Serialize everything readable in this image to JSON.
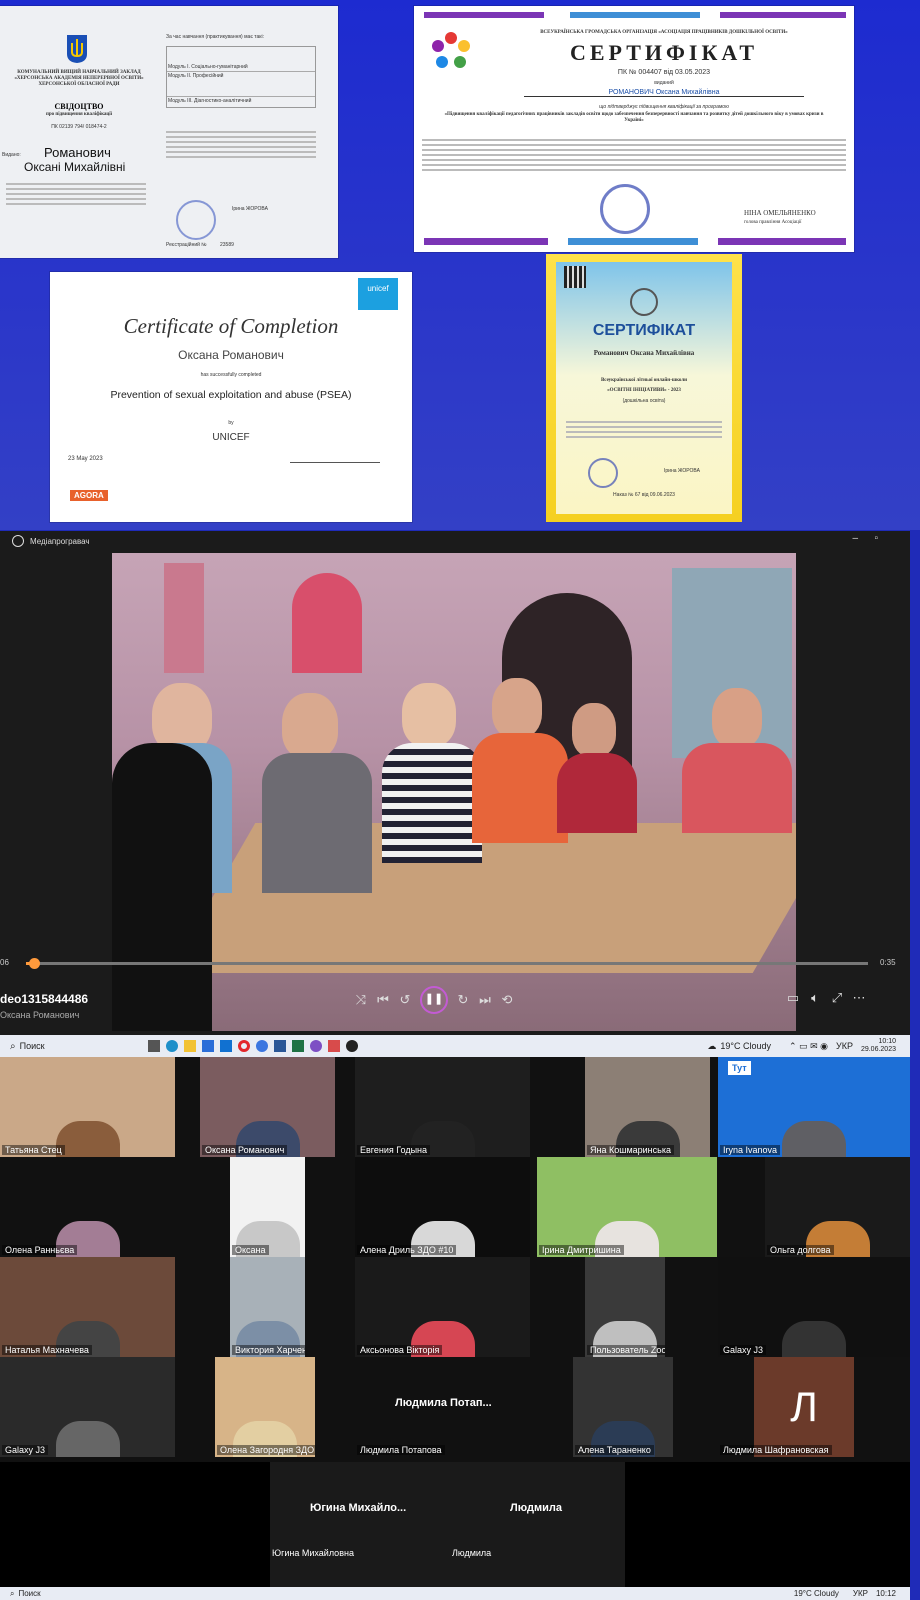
{
  "collage": {
    "cert_left": {
      "institution": "КОМУНАЛЬНИЙ ВИЩИЙ НАВЧАЛЬНИЙ ЗАКЛАД «ХЕРСОНСЬКА АКАДЕМІЯ НЕПЕРЕРВНОЇ ОСВІТИ» ХЕРСОНСЬКОЇ ОБЛАСНОЇ РАДИ",
      "title": "СВІДОЦТВО",
      "subtitle": "про підвищення кваліфікації",
      "number": "ПК 02139 794/ 018474-2",
      "issued_label": "Видано:",
      "surname": "Романович",
      "name": "Оксані Михайлівні",
      "head": "Ірина ЖОРОВА",
      "reg_label": "Реєстраційний №",
      "reg_number": "23589",
      "table_header": "За час навчання (практикування) має такі:",
      "module_1": "Модуль I. Соціально-гуманітарний",
      "module_2": "Модуль II. Професійний",
      "module_3": "Модуль III. Діагностико-аналітичний"
    },
    "cert_assoc": {
      "org": "ВСЕУКРАЇНСЬКА ГРОМАДСЬКА ОРГАНІЗАЦІЯ «АСОЦІАЦІЯ ПРАЦІВНИКІВ ДОШКІЛЬНОЇ ОСВІТИ»",
      "title": "СЕРТИФІКАТ",
      "number_line": "ПК № 004407 від 03.05.2023",
      "issued": "виданий",
      "recipient": "РОМАНОВИЧ Оксана Михайлівна",
      "confirms": "що підтверджує підвищення кваліфікації за програмою",
      "program": "«Підвищення кваліфікації педагогічних працівників закладів освіти щодо забезпечення безперервності навчання та розвитку дітей дошкільного віку в умовах кризи в Україні»",
      "signer": "НІНА ОМЕЛЬЯНЕНКО",
      "signer_role": "голова правління Асоціації"
    },
    "cert_unicef": {
      "title": "Certificate of Completion",
      "name": "Оксана Романович",
      "completed": "has successfully completed",
      "course": "Prevention of sexual exploitation and abuse (PSEA)",
      "by": "by",
      "issuer": "UNICEF",
      "date": "23 May 2023",
      "logo": "unicef",
      "agora": "AGORA"
    },
    "cert_summer": {
      "title": "СЕРТИФІКАТ",
      "name": "Романович Оксана Михайлівна",
      "school": "Всеукраїнської літньої онлайн-школи",
      "theme": "«ОСВІТНІ ІНІЦІАТИВИ» - 2023",
      "sub": "(дошкільна освіта)",
      "head": "Ірина ЖОРОВА",
      "number": "Наказ № 67 від 09.06.2023"
    }
  },
  "player": {
    "app_title": "Медіапрогравач",
    "time_start": "06",
    "time_end": "0:35",
    "file_name": "deo1315844486",
    "subtitle": "Оксана Романович",
    "progress_fraction": 0.01
  },
  "taskbar1": {
    "search": "Поиск",
    "weather": "19°C Cloudy",
    "lang": "УКР",
    "time": "10:10",
    "date": "29.06.2023"
  },
  "taskbar2": {
    "search": "Поиск",
    "weather": "19°C Cloudy",
    "lang": "УКР",
    "time": "10:12"
  },
  "zoom": {
    "participants": [
      "Татьяна Стец",
      "Оксана Романович",
      "Евгения Годына",
      "Яна Кошмаринська",
      "Iryna Ivanova",
      "Олена Ранньєва",
      "Оксана",
      "Алена Дриль ЗДО #10",
      "Ірина Дмитришина",
      "Ольга долгова",
      "Наталья Махначева",
      "Виктория Харченко",
      "Аксьонова Вікторія",
      "Пользователь Zoom Оксана ЗДО 10",
      "Galaxy J3",
      "Олена Загородня ЗДО№10 м.Херсон",
      "Людмила Потапова",
      "Алена Тараненко",
      "Людмила Шафрановская",
      "Югина Михайловна",
      "Людмила"
    ],
    "big_name_1": "Людмила Потап...",
    "big_name_2": "Югина Михайло...",
    "big_name_3": "Людмила",
    "avatar_letter": "Л",
    "iryna_badge": "Тут"
  }
}
